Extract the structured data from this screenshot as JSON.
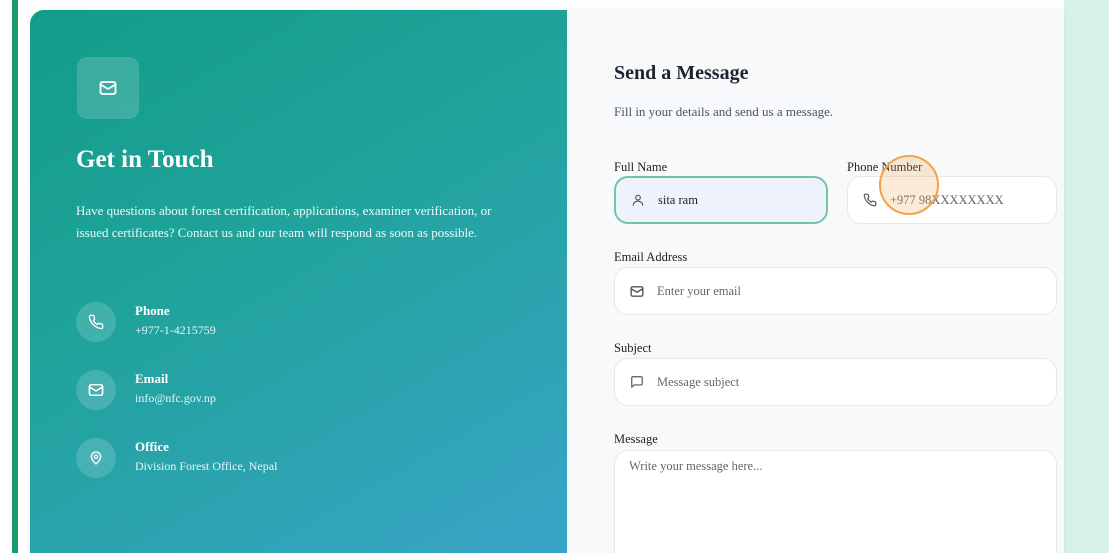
{
  "info": {
    "title": "Get in Touch",
    "description": "Have questions about forest certification, applications, examiner verification, or issued certificates? Contact us and our team will respond as soon as possible.",
    "contacts": [
      {
        "label": "Phone",
        "value": "+977-1-4215759",
        "icon": "phone-icon"
      },
      {
        "label": "Email",
        "value": "info@nfc.gov.np",
        "icon": "mail-icon"
      },
      {
        "label": "Office",
        "value": "Division Forest Office, Nepal",
        "icon": "map-pin-icon"
      }
    ]
  },
  "form": {
    "title": "Send a Message",
    "subtitle": "Fill in your details and send us a message.",
    "full_name": {
      "label": "Full Name",
      "value": "sita ram",
      "icon": "user-icon"
    },
    "phone": {
      "label": "Phone Number",
      "placeholder": "+977 98XXXXXXXX",
      "icon": "phone-icon"
    },
    "email": {
      "label": "Email Address",
      "placeholder": "Enter your email",
      "icon": "mail-icon"
    },
    "subject": {
      "label": "Subject",
      "placeholder": "Message subject",
      "icon": "message-square-icon"
    },
    "message": {
      "label": "Message",
      "placeholder": "Write your message here..."
    }
  },
  "colors": {
    "accent_green": "#1a9b6f",
    "panel_gradient_start": "#129c88",
    "panel_gradient_end": "#3aa4c9",
    "focus_border": "#74c4a4",
    "cursor_highlight": "#f2a24a"
  }
}
